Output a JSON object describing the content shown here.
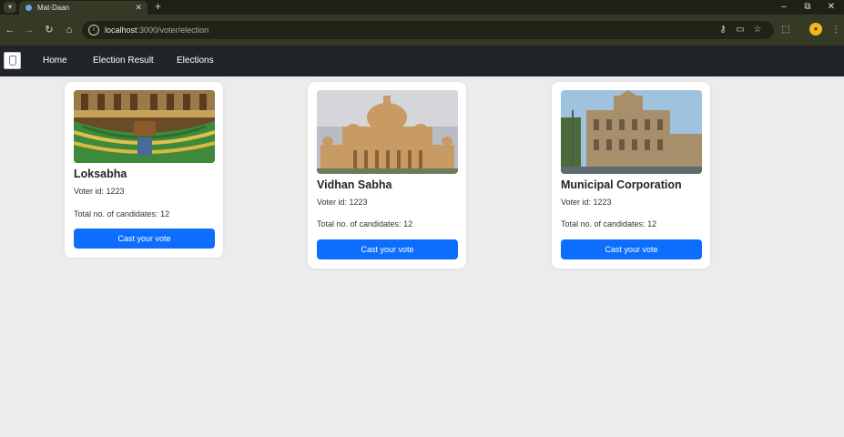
{
  "browser": {
    "tab_title": "Mat-Daan",
    "url_host": "localhost",
    "url_path": ":3000/voter/election"
  },
  "navbar": {
    "links": [
      {
        "label": "Home"
      },
      {
        "label": "Election Result"
      },
      {
        "label": "Elections"
      }
    ]
  },
  "elections": [
    {
      "title": "Loksabha",
      "voter_id": "Voter id: 1223",
      "candidates": "Total no. of candidates: 12",
      "button": "Cast your vote"
    },
    {
      "title": "Vidhan Sabha",
      "voter_id": "Voter id: 1223",
      "candidates": "Total no. of candidates: 12",
      "button": "Cast your vote"
    },
    {
      "title": "Municipal Corporation",
      "voter_id": "Voter id: 1223",
      "candidates": "Total no. of candidates: 12",
      "button": "Cast your vote"
    }
  ],
  "colors": {
    "primary_button": "#0d6efd",
    "navbar": "#212529",
    "page_background": "#ececec"
  }
}
